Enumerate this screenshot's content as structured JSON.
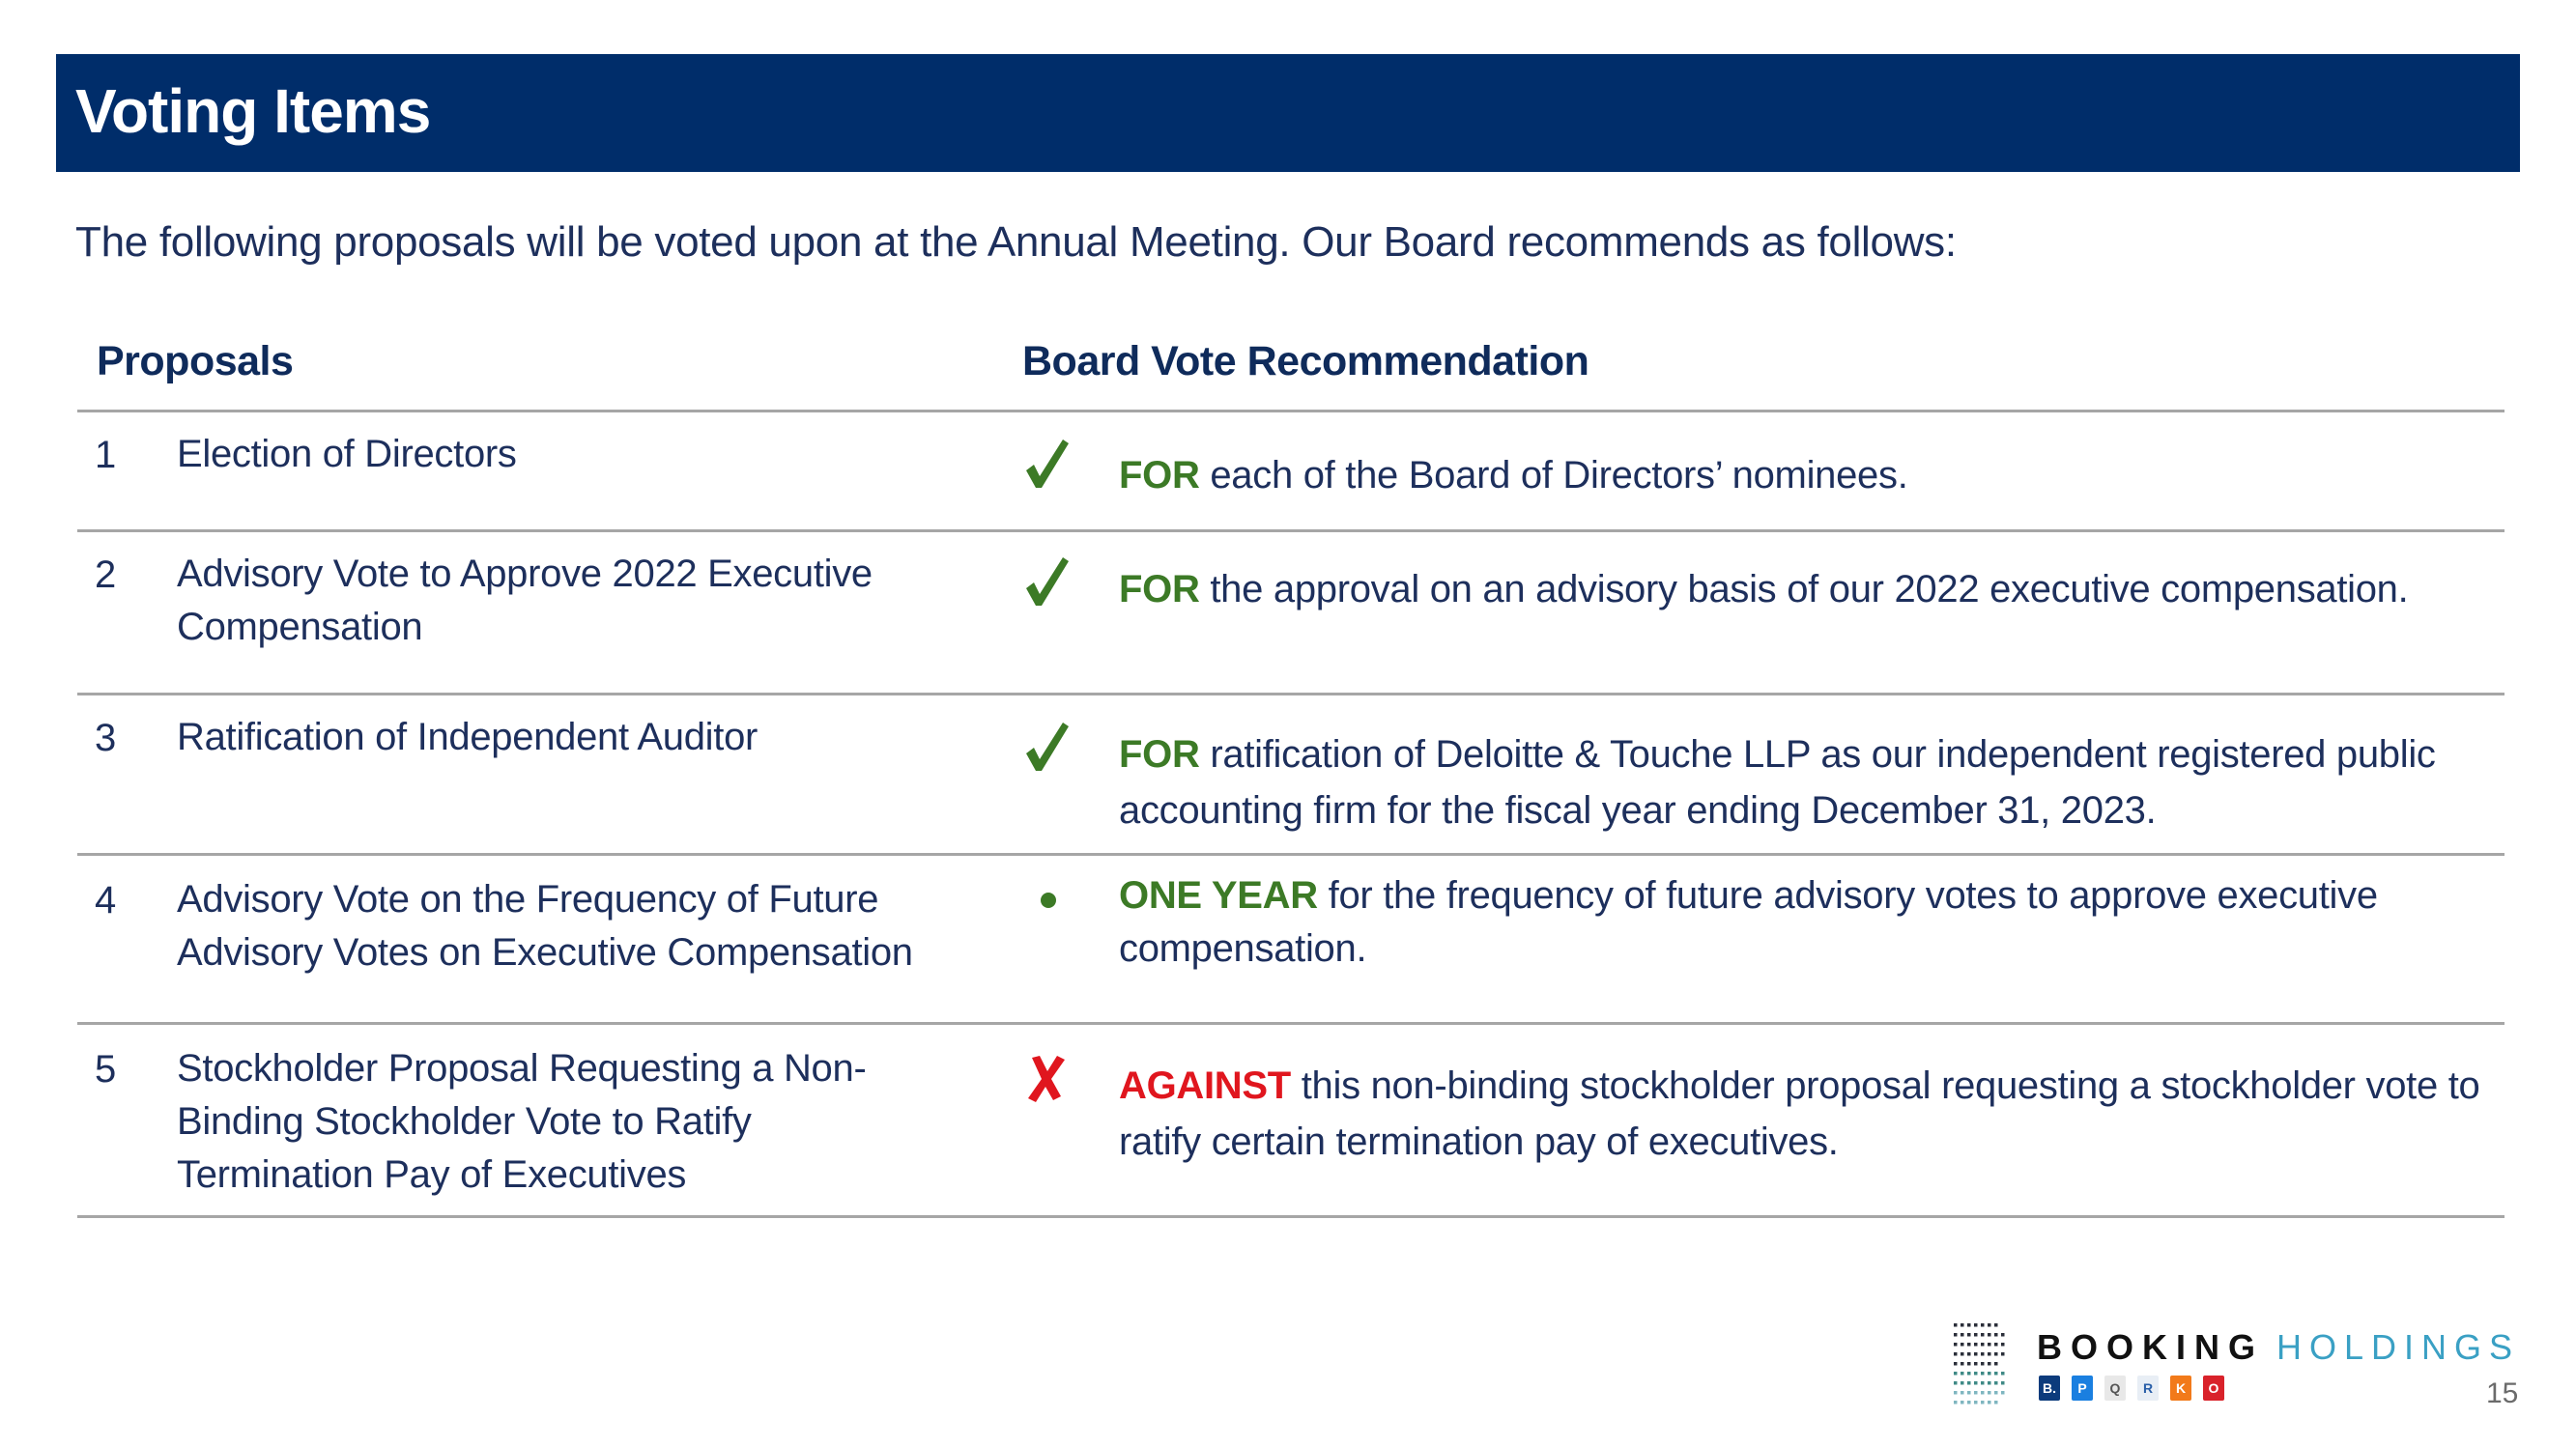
{
  "slide": {
    "title": "Voting Items",
    "intro": "The following proposals will be voted upon at the Annual Meeting. Our Board recommends as follows:",
    "page_number": "15"
  },
  "table": {
    "headers": {
      "proposals": "Proposals",
      "recommendation": "Board Vote Recommendation"
    },
    "rows": [
      {
        "number": "1",
        "proposal": "Election of Directors",
        "icon": "checkmark-icon",
        "keyword": "FOR",
        "keyword_color": "#3c7a26",
        "recommendation": " each of the Board of Directors’ nominees."
      },
      {
        "number": "2",
        "proposal": "Advisory Vote to Approve 2022 Executive Compensation",
        "icon": "checkmark-icon",
        "keyword": "FOR",
        "keyword_color": "#3c7a26",
        "recommendation": " the approval on an advisory basis of our 2022 executive compensation."
      },
      {
        "number": "3",
        "proposal": "Ratification of Independent Auditor",
        "icon": "checkmark-icon",
        "keyword": "FOR",
        "keyword_color": "#3c7a26",
        "recommendation": " ratification of Deloitte & Touche LLP as our independent registered public accounting firm for the fiscal year ending December 31, 2023."
      },
      {
        "number": "4",
        "proposal": "Advisory Vote on the Frequency of Future Advisory Votes on Executive Compensation",
        "icon": "bullet-dot-icon",
        "keyword": "ONE YEAR",
        "keyword_color": "#3c7a26",
        "recommendation": " for the frequency of future advisory votes to approve executive compensation."
      },
      {
        "number": "5",
        "proposal": "Stockholder Proposal Requesting a Non-Binding Stockholder Vote to Ratify Termination Pay of Executives",
        "icon": "cross-x-icon",
        "keyword": "AGAINST",
        "keyword_color": "#e0161e",
        "recommendation": " this non-binding stockholder proposal requesting a stockholder vote to ratify certain termination pay of executives."
      }
    ]
  },
  "logo": {
    "word_primary": "BOOKING",
    "word_secondary": "HOLDINGS",
    "brand_tiles": [
      {
        "label": "B.",
        "color": "#0c3b7c",
        "text_color": "#ffffff"
      },
      {
        "label": "P",
        "color": "#1a7fe0",
        "text_color": "#ffffff"
      },
      {
        "label": "Q",
        "color": "#e8e8e8",
        "text_color": "#555555"
      },
      {
        "label": "R",
        "color": "#e8eef5",
        "text_color": "#2a5fa8"
      },
      {
        "label": "K",
        "color": "#f27a1a",
        "text_color": "#ffffff"
      },
      {
        "label": "O",
        "color": "#d9222a",
        "text_color": "#ffffff"
      }
    ]
  },
  "colors": {
    "header_bg": "#002d6a",
    "text": "#1d2f5c",
    "for_green": "#3c7a26",
    "against_red": "#e0161e",
    "holdings_blue": "#3aa0c4"
  }
}
